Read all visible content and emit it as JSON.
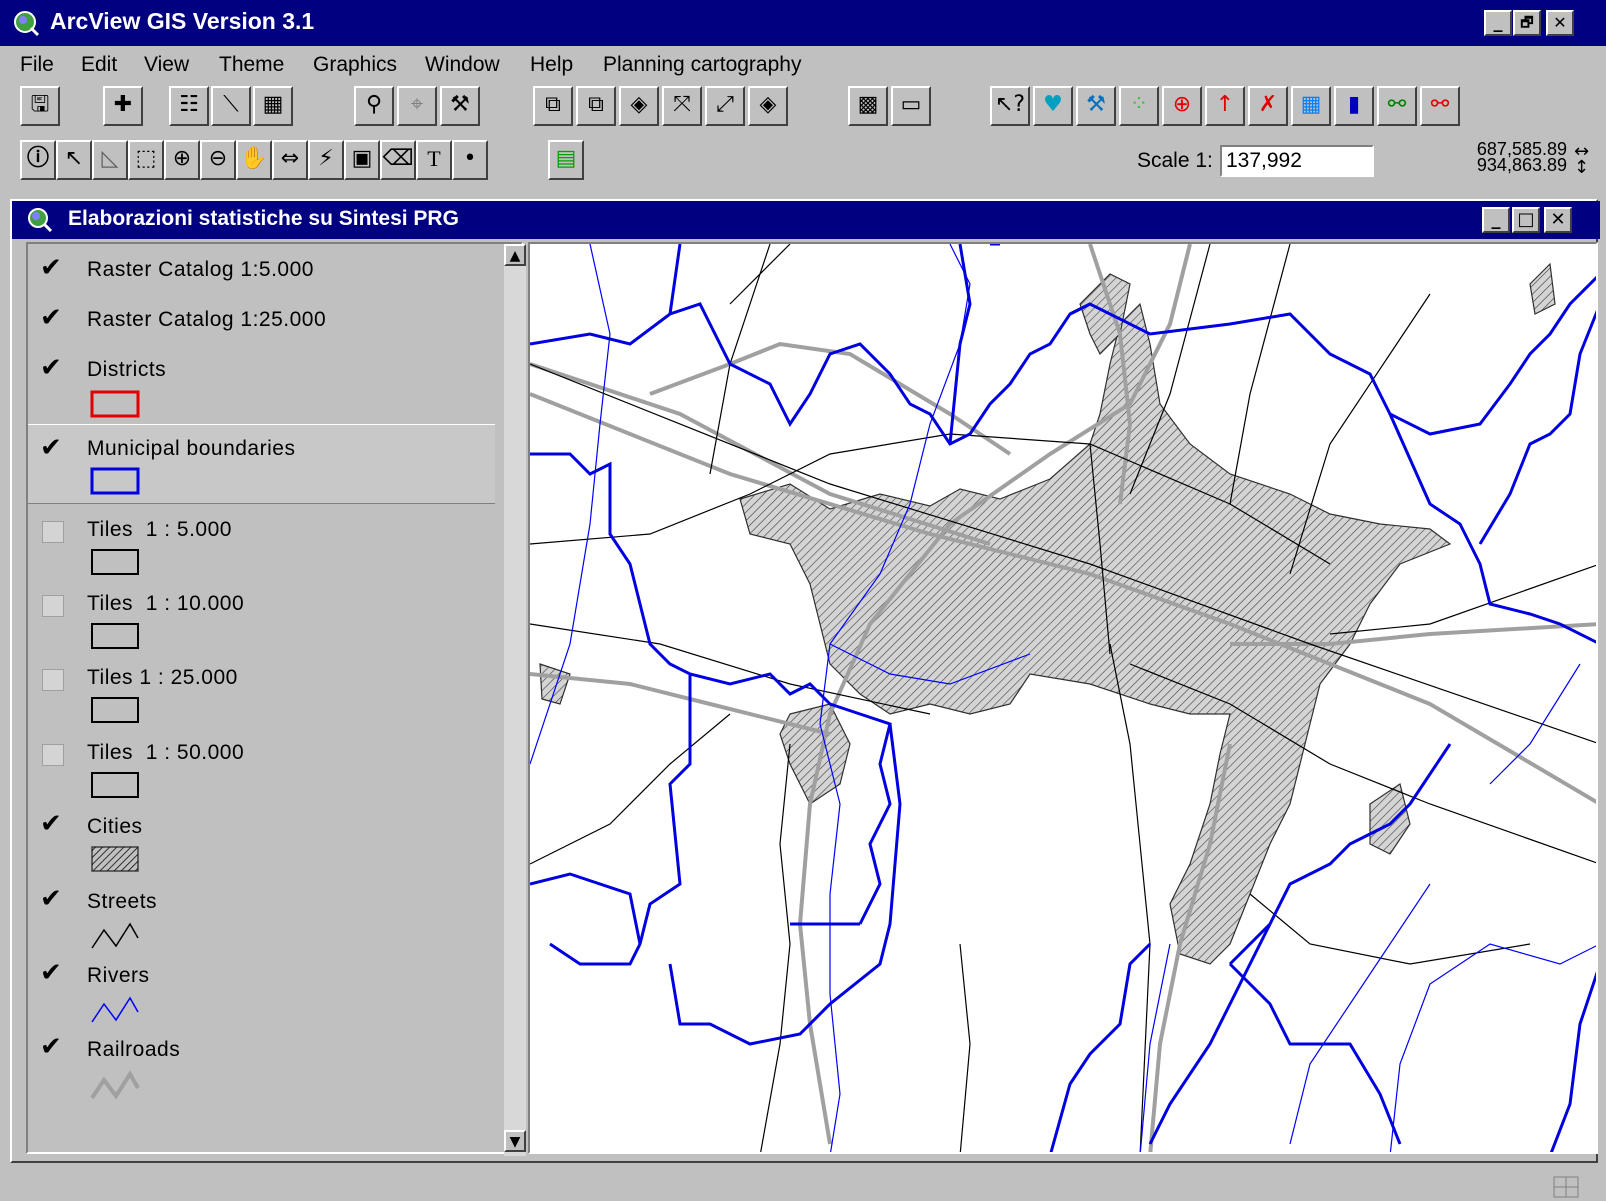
{
  "app": {
    "title": "ArcView GIS Version 3.1",
    "window_buttons": [
      "_",
      "🗗",
      "✕"
    ]
  },
  "menu": [
    "File",
    "Edit",
    "View",
    "Theme",
    "Graphics",
    "Window",
    "Help",
    "Planning cartography"
  ],
  "toolbar": {
    "scale_label": "Scale 1:",
    "scale_value": "137,992",
    "coord_x": "687,585.89",
    "coord_y": "934,863.89"
  },
  "view": {
    "title": "Elaborazioni statistiche su Sintesi PRG",
    "window_buttons": [
      "_",
      "□",
      "✕"
    ]
  },
  "layers": [
    {
      "label": "Raster Catalog 1:5.000",
      "checked": true,
      "symbol": "none"
    },
    {
      "label": "Raster Catalog 1:25.000",
      "checked": true,
      "symbol": "none"
    },
    {
      "label": "Districts",
      "checked": true,
      "symbol": "polygon",
      "color": "#e00000"
    },
    {
      "label": "Municipal boundaries",
      "checked": true,
      "symbol": "polygon",
      "color": "#0000e0",
      "active": true
    },
    {
      "label": "Tiles  1 : 5.000",
      "checked": false,
      "symbol": "polygon",
      "color": "#000000"
    },
    {
      "label": "Tiles  1 : 10.000",
      "checked": false,
      "symbol": "polygon",
      "color": "#000000"
    },
    {
      "label": "Tiles 1 : 25.000",
      "checked": false,
      "symbol": "polygon",
      "color": "#000000"
    },
    {
      "label": "Tiles  1 : 50.000",
      "checked": false,
      "symbol": "polygon",
      "color": "#000000"
    },
    {
      "label": "Cities",
      "checked": true,
      "symbol": "hatch",
      "color": "#000000"
    },
    {
      "label": "Streets",
      "checked": true,
      "symbol": "line",
      "color": "#000000"
    },
    {
      "label": "Rivers",
      "checked": true,
      "symbol": "line",
      "color": "#0000ff"
    },
    {
      "label": "Railroads",
      "checked": true,
      "symbol": "thickline",
      "color": "#a0a0a0"
    }
  ],
  "colors": {
    "titlebar": "#000080",
    "face": "#c0c0c0",
    "boundary": "#0000e0",
    "river": "#0000ff",
    "railroad": "#a0a0a0"
  }
}
